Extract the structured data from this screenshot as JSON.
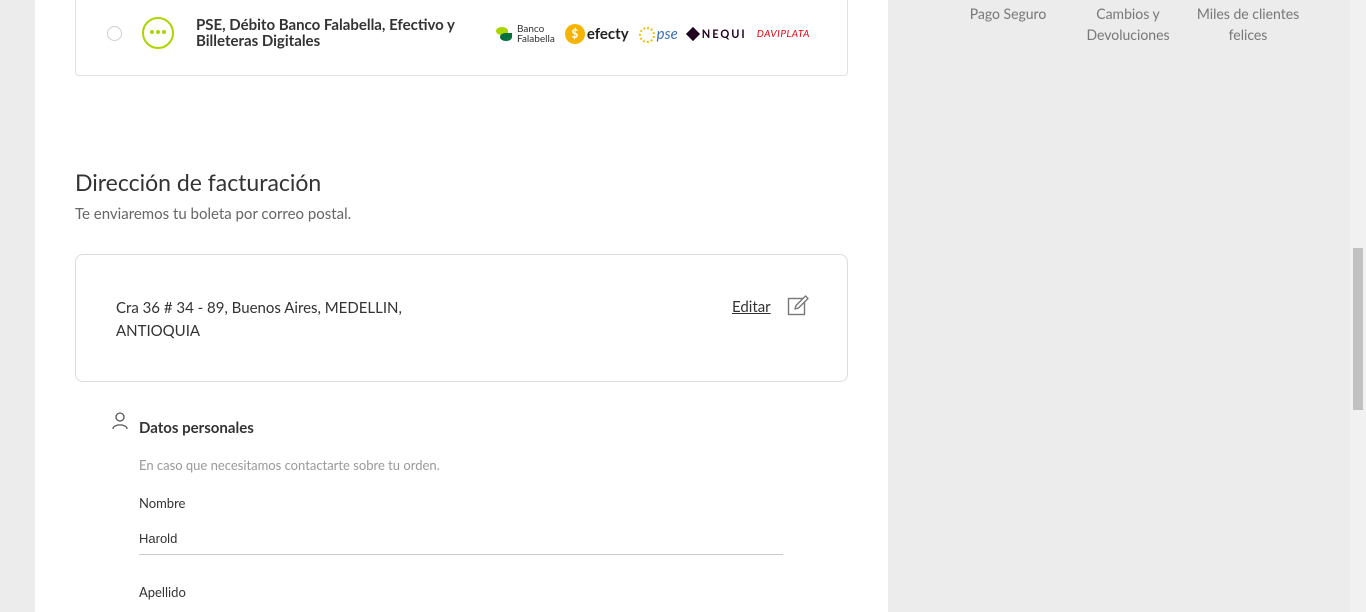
{
  "payment_option": {
    "title": "PSE, Débito Banco Falabella, Efectivo y Billeteras Digitales",
    "logos": {
      "banco_falabella_line1": "Banco",
      "banco_falabella_line2": "Falabella",
      "efecty": "efecty",
      "pse": "pse",
      "nequi": "NEQUI",
      "daviplata": "DAVIPLATA"
    }
  },
  "billing": {
    "heading": "Dirección de facturación",
    "subheading": "Te enviaremos tu boleta por correo postal.",
    "address": "Cra 36 # 34 - 89, Buenos Aires, MEDELLIN, ANTIOQUIA",
    "edit_label": "Editar"
  },
  "personal": {
    "title": "Datos personales",
    "help": "En caso que necesitamos contactarte sobre tu orden.",
    "first_name_label": "Nombre",
    "first_name_value": "Harold",
    "last_name_label": "Apellido"
  },
  "sidebar": {
    "badges": [
      "Pago Seguro",
      "Cambios y Devoluciones",
      "Miles de clientes felices"
    ]
  }
}
